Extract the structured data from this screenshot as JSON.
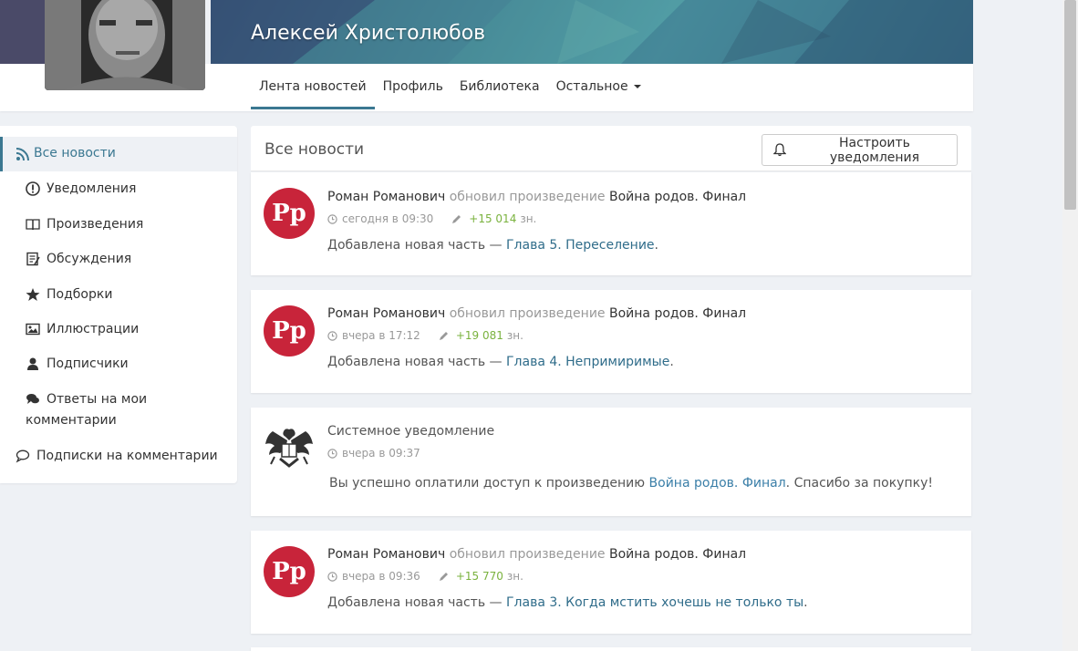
{
  "profile": {
    "name": "Алексей Христолюбов"
  },
  "nav": {
    "items": [
      "Лента новостей",
      "Профиль",
      "Библиотека"
    ],
    "more_label": "Остальное"
  },
  "sidebar": {
    "items": [
      {
        "label": "Все новости",
        "icon": "rss-icon"
      },
      {
        "label": "Уведомления",
        "icon": "alert-circle-icon"
      },
      {
        "label": "Произведения",
        "icon": "book-icon"
      },
      {
        "label": "Обсуждения",
        "icon": "discussion-icon"
      },
      {
        "label": "Подборки",
        "icon": "star-icon"
      },
      {
        "label": "Иллюстрации",
        "icon": "image-icon"
      },
      {
        "label": "Подписчики",
        "icon": "user-icon"
      },
      {
        "label": "Ответы на мои",
        "label2": "комментарии",
        "icon": "comments-icon"
      },
      {
        "label": "Подписки на комментарии",
        "icon": "comment-icon"
      }
    ]
  },
  "feed": {
    "title": "Все новости",
    "notify_button": "Настроить уведомления",
    "cards": [
      {
        "author": "Роман Романович",
        "action": "обновил произведение",
        "work": "Война родов. Финал",
        "time": "сегодня в 09:30",
        "chars": "+15 014",
        "chars_unit": "зн.",
        "text_prefix": "Добавлена новая часть — ",
        "chapter": "Глава 5. Переселение",
        "text_suffix": "."
      },
      {
        "author": "Роман Романович",
        "action": "обновил произведение",
        "work": "Война родов. Финал",
        "time": "вчера в 17:12",
        "chars": "+19 081",
        "chars_unit": "зн.",
        "text_prefix": "Добавлена новая часть — ",
        "chapter": "Глава 4. Непримиримые",
        "text_suffix": "."
      },
      {
        "system_title": "Системное уведомление",
        "time": "вчера в 09:37",
        "text_prefix": "Вы успешно оплатили доступ к произведению ",
        "work_link": "Война родов. Финал",
        "text_suffix": ". Спасибо за покупку!"
      },
      {
        "author": "Роман Романович",
        "action": "обновил произведение",
        "work": "Война родов. Финал",
        "time": "вчера в 09:36",
        "chars": "+15 770",
        "chars_unit": "зн.",
        "text_prefix": "Добавлена новая часть — ",
        "chapter": "Глава 3. Когда мстить хочешь не только ты",
        "text_suffix": "."
      }
    ],
    "publisher_logo_text": "Рр"
  },
  "colors": {
    "accent": "#3b7891",
    "publisher": "#c8243a",
    "green": "#7ab23e"
  }
}
